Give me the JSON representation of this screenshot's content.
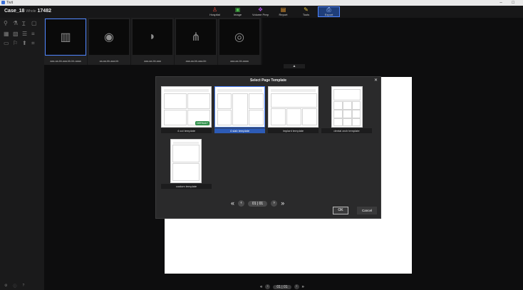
{
  "window": {
    "title": "Tivit",
    "controls": "– □"
  },
  "case": {
    "name": "Case_18",
    "patient_label": "Whole",
    "id": "17482"
  },
  "nav": [
    {
      "label": "Hospital",
      "icon": "person-icon",
      "color": "#e24a3b"
    },
    {
      "label": "Image",
      "icon": "tooth-image-icon",
      "color": "#4bc04b"
    },
    {
      "label": "Volume Prep",
      "icon": "volume-icon",
      "color": "#a64be0"
    },
    {
      "label": "Report",
      "icon": "report-icon",
      "color": "#e89a2f"
    },
    {
      "label": "Tools",
      "icon": "tools-icon",
      "color": "#e7c23a"
    },
    {
      "label": "Export",
      "icon": "export-icon",
      "color": "#4f86ff"
    }
  ],
  "thumbnails": [
    {
      "label": "aaa-aa-bb-aaa-bb-bb-aaaa",
      "glyph": "▥"
    },
    {
      "label": "aa-aa-bb-aaa-bb",
      "glyph": "◉"
    },
    {
      "label": "aaa-aa-bb-aaa",
      "glyph": "◗"
    },
    {
      "label": "aaa-aa-bb-aaa-bb",
      "glyph": "⋔"
    },
    {
      "label": "aaa-aa-bb-aaaa",
      "glyph": "◎"
    }
  ],
  "dialog": {
    "title": "Select Page Template",
    "templates": [
      {
        "label": "4 cut template",
        "badge": "DEFAULT"
      },
      {
        "label": "4 slab template"
      },
      {
        "label": "implant template"
      },
      {
        "label": "dental arch template"
      },
      {
        "label": "custom template"
      }
    ],
    "pager": {
      "text": "01 | 01"
    },
    "ok_label": "OK",
    "cancel_label": "Cancel"
  },
  "bottom_pager": {
    "text": "01 | 01"
  }
}
